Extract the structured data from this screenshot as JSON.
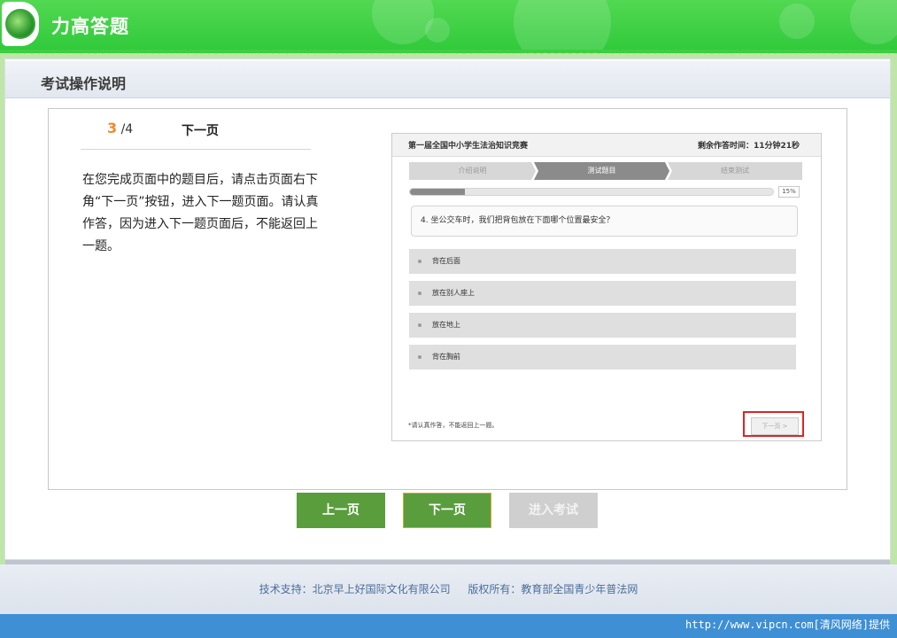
{
  "app": {
    "title": "力高答题"
  },
  "section": {
    "title": "考试操作说明"
  },
  "step": {
    "current": "3",
    "total": "/4",
    "next_label": "下一页"
  },
  "instruction": {
    "text": "在您完成页面中的题目后，请点击页面右下角“下一页”按钮，进入下一题页面。请认真作答，因为进入下一题页面后，不能返回上一题。"
  },
  "preview": {
    "title": "第一届全国中小学生法治知识竞赛",
    "timer": "剩余作答时间：11分钟21秒",
    "steps": [
      "介绍说明",
      "测试题目",
      "结束测试"
    ],
    "progress_percent": 15,
    "progress_label": "15%",
    "question": "4.   坐公交车时，我们把背包放在下面哪个位置最安全？",
    "options": [
      "背在后面",
      "放在别人座上",
      "放在地上",
      "背在胸前"
    ],
    "note": "*请认真作答，不能返回上一题。",
    "next_button": "下一页 >"
  },
  "buttons": {
    "prev": "上一页",
    "next": "下一页",
    "enter_exam": "进入考试"
  },
  "footer": {
    "support": "技术支持：北京早上好国际文化有限公司",
    "copyright": "版权所有：教育部全国青少年普法网"
  },
  "watermark": "http://www.vipcn.com[清风网络]提供",
  "colors": {
    "header_green": "#3fce42",
    "button_green": "#5a9d3d",
    "step_accent": "#ef8a2e",
    "highlight_red": "#d92626",
    "footer_text": "#4b6e9b",
    "bottom_bar": "#3e8fd4"
  }
}
